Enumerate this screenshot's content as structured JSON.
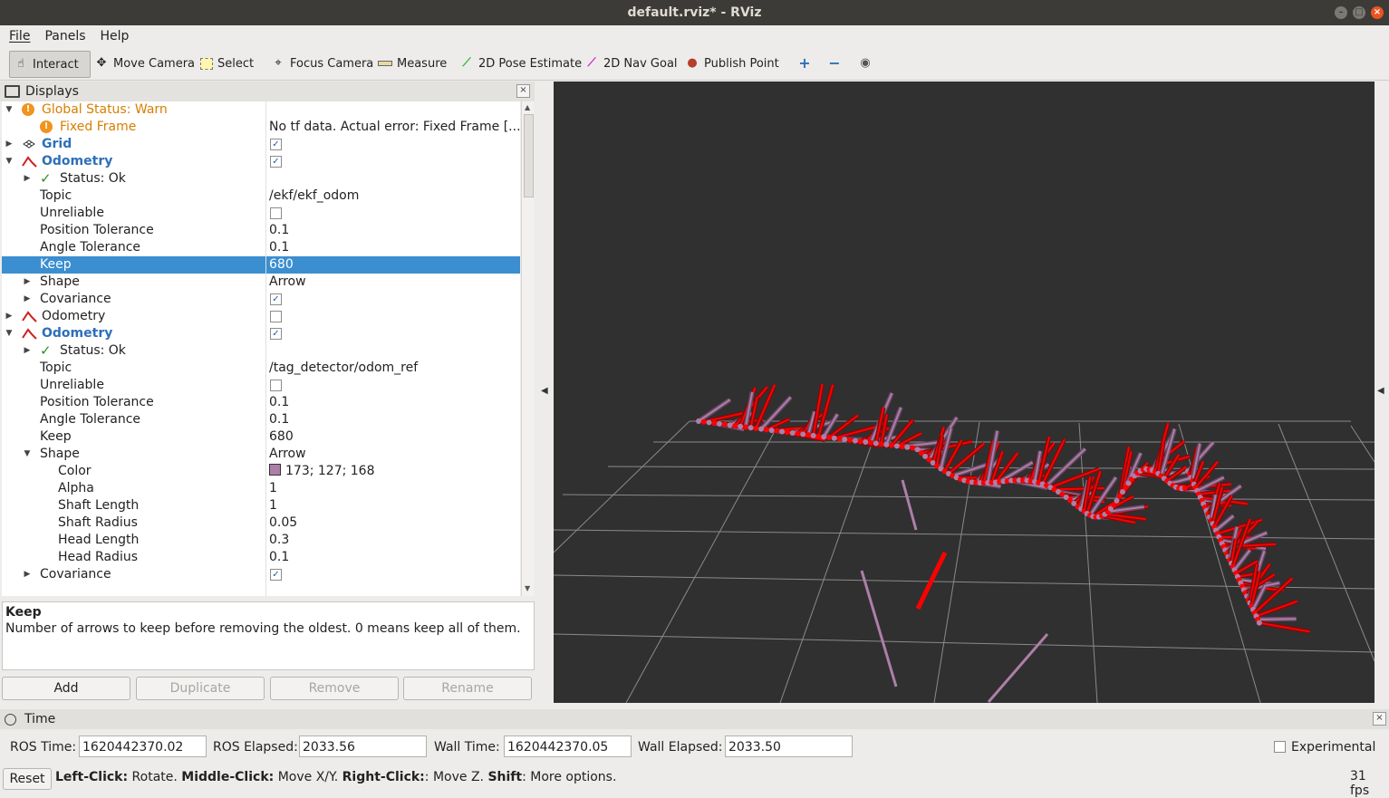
{
  "window": {
    "title": "default.rviz* - RViz"
  },
  "menu": {
    "file": "File",
    "panels": "Panels",
    "help": "Help"
  },
  "toolbar": {
    "interact": "Interact",
    "move_camera": "Move Camera",
    "select": "Select",
    "focus_camera": "Focus Camera",
    "measure": "Measure",
    "pose_estimate": "2D Pose Estimate",
    "nav_goal": "2D Nav Goal",
    "publish_point": "Publish Point"
  },
  "displays": {
    "title": "Displays",
    "rows": [
      {
        "name": "Global Status: Warn",
        "value": ""
      },
      {
        "name": "Fixed Frame",
        "value": "No tf data.  Actual error: Fixed Frame [..."
      },
      {
        "name": "Grid",
        "value": ""
      },
      {
        "name": "Odometry",
        "value": ""
      },
      {
        "name": "Status: Ok",
        "value": ""
      },
      {
        "name": "Topic",
        "value": "/ekf/ekf_odom"
      },
      {
        "name": "Unreliable",
        "value": ""
      },
      {
        "name": "Position Tolerance",
        "value": "0.1"
      },
      {
        "name": "Angle Tolerance",
        "value": "0.1"
      },
      {
        "name": "Keep",
        "value": "680"
      },
      {
        "name": "Shape",
        "value": "Arrow"
      },
      {
        "name": "Covariance",
        "value": ""
      },
      {
        "name": "Odometry",
        "value": ""
      },
      {
        "name": "Odometry",
        "value": ""
      },
      {
        "name": "Status: Ok",
        "value": ""
      },
      {
        "name": "Topic",
        "value": "/tag_detector/odom_ref"
      },
      {
        "name": "Unreliable",
        "value": ""
      },
      {
        "name": "Position Tolerance",
        "value": "0.1"
      },
      {
        "name": "Angle Tolerance",
        "value": "0.1"
      },
      {
        "name": "Keep",
        "value": "680"
      },
      {
        "name": "Shape",
        "value": "Arrow"
      },
      {
        "name": "Color",
        "value": "173; 127; 168"
      },
      {
        "name": "Alpha",
        "value": "1"
      },
      {
        "name": "Shaft Length",
        "value": "1"
      },
      {
        "name": "Shaft Radius",
        "value": "0.05"
      },
      {
        "name": "Head Length",
        "value": "0.3"
      },
      {
        "name": "Head Radius",
        "value": "0.1"
      },
      {
        "name": "Covariance",
        "value": ""
      }
    ],
    "checked": [
      false,
      false,
      true,
      true,
      false,
      false,
      false,
      false,
      false,
      false,
      false,
      true,
      false,
      true,
      false,
      false,
      false,
      false,
      false,
      false,
      false,
      false,
      false,
      false,
      false,
      false,
      false,
      true
    ],
    "description_title": "Keep",
    "description_text": "Number of arrows to keep before removing the oldest. 0 means keep all of them.",
    "buttons": {
      "add": "Add",
      "duplicate": "Duplicate",
      "remove": "Remove",
      "rename": "Rename"
    }
  },
  "colors": {
    "odometry_arrow_1": "#ff0000",
    "odometry_arrow_2": "#ad7fa8",
    "selection": "#3b8ed0"
  },
  "time": {
    "title": "Time",
    "ros_time_label": "ROS Time:",
    "ros_time": "1620442370.02",
    "ros_elapsed_label": "ROS Elapsed:",
    "ros_elapsed": "2033.56",
    "wall_time_label": "Wall Time:",
    "wall_time": "1620442370.05",
    "wall_elapsed_label": "Wall Elapsed:",
    "wall_elapsed": "2033.50",
    "experimental": "Experimental"
  },
  "status": {
    "reset": "Reset",
    "left_click": "Left-Click:",
    "left_click_desc": " Rotate. ",
    "middle_click": "Middle-Click:",
    "middle_click_desc": " Move X/Y. ",
    "right_click": "Right-Click:",
    "right_click_desc": ": Move Z. ",
    "shift": "Shift",
    "shift_desc": ": More options.",
    "fps": "31 fps"
  }
}
